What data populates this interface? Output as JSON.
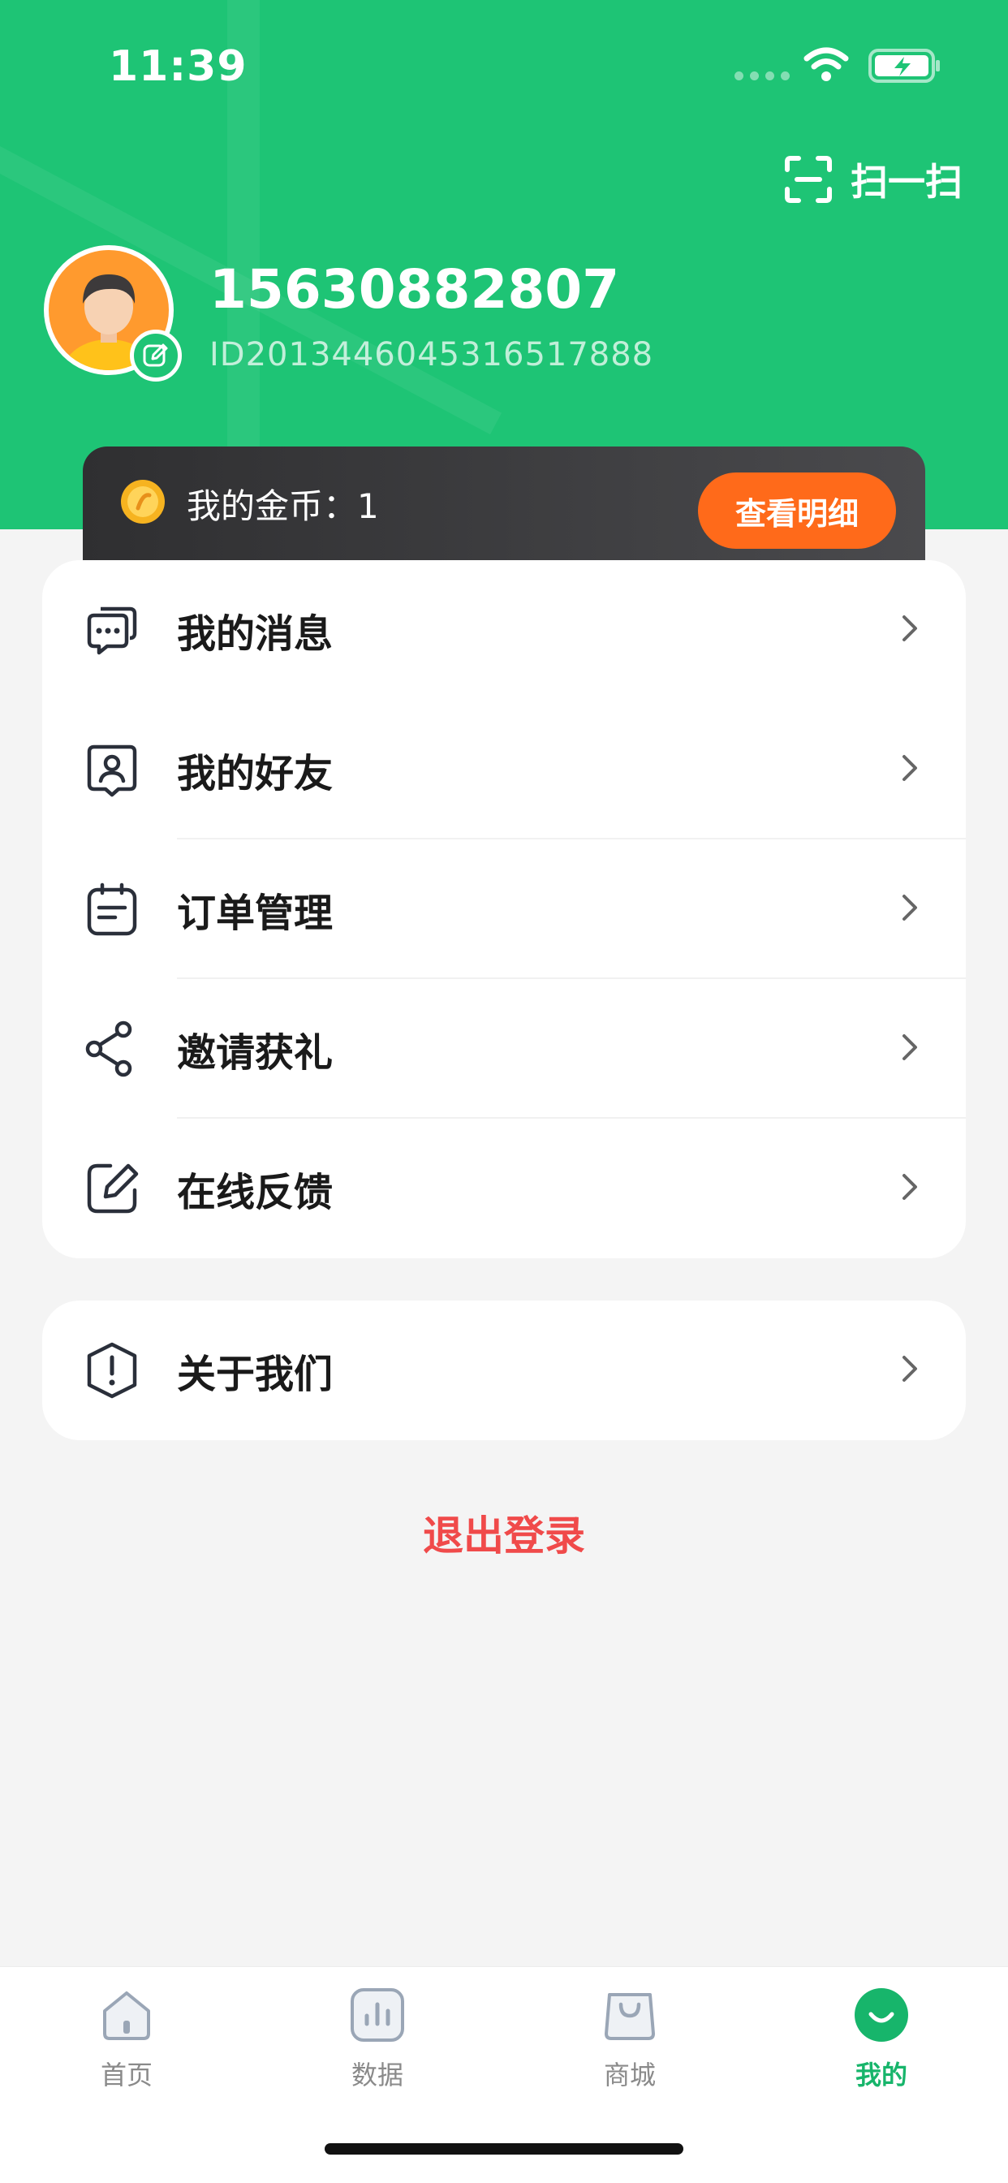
{
  "status_bar": {
    "time": "11:39"
  },
  "header": {
    "scan_label": "扫一扫",
    "username": "15630882807",
    "user_id": "ID2013446045316517888"
  },
  "coins": {
    "label": "我的金币：1",
    "detail_button": "查看明细"
  },
  "menu_group_1": {
    "items": [
      {
        "label": "我的消息",
        "icon": "message-icon"
      },
      {
        "label": "我的好友",
        "icon": "friend-icon"
      },
      {
        "label": "订单管理",
        "icon": "order-icon"
      },
      {
        "label": "邀请获礼",
        "icon": "share-icon"
      },
      {
        "label": "在线反馈",
        "icon": "feedback-icon"
      }
    ]
  },
  "menu_group_2": {
    "items": [
      {
        "label": "关于我们",
        "icon": "about-icon"
      }
    ]
  },
  "logout_label": "退出登录",
  "tabbar": {
    "items": [
      {
        "label": "首页",
        "icon": "home-icon",
        "active": false
      },
      {
        "label": "数据",
        "icon": "chart-icon",
        "active": false
      },
      {
        "label": "商城",
        "icon": "shop-icon",
        "active": false
      },
      {
        "label": "我的",
        "icon": "profile-icon",
        "active": true
      }
    ]
  },
  "colors": {
    "brand_green": "#1ec475",
    "accent_orange": "#ff6a1a",
    "logout_red": "#f04a4a",
    "page_bg": "#f4f4f4"
  }
}
